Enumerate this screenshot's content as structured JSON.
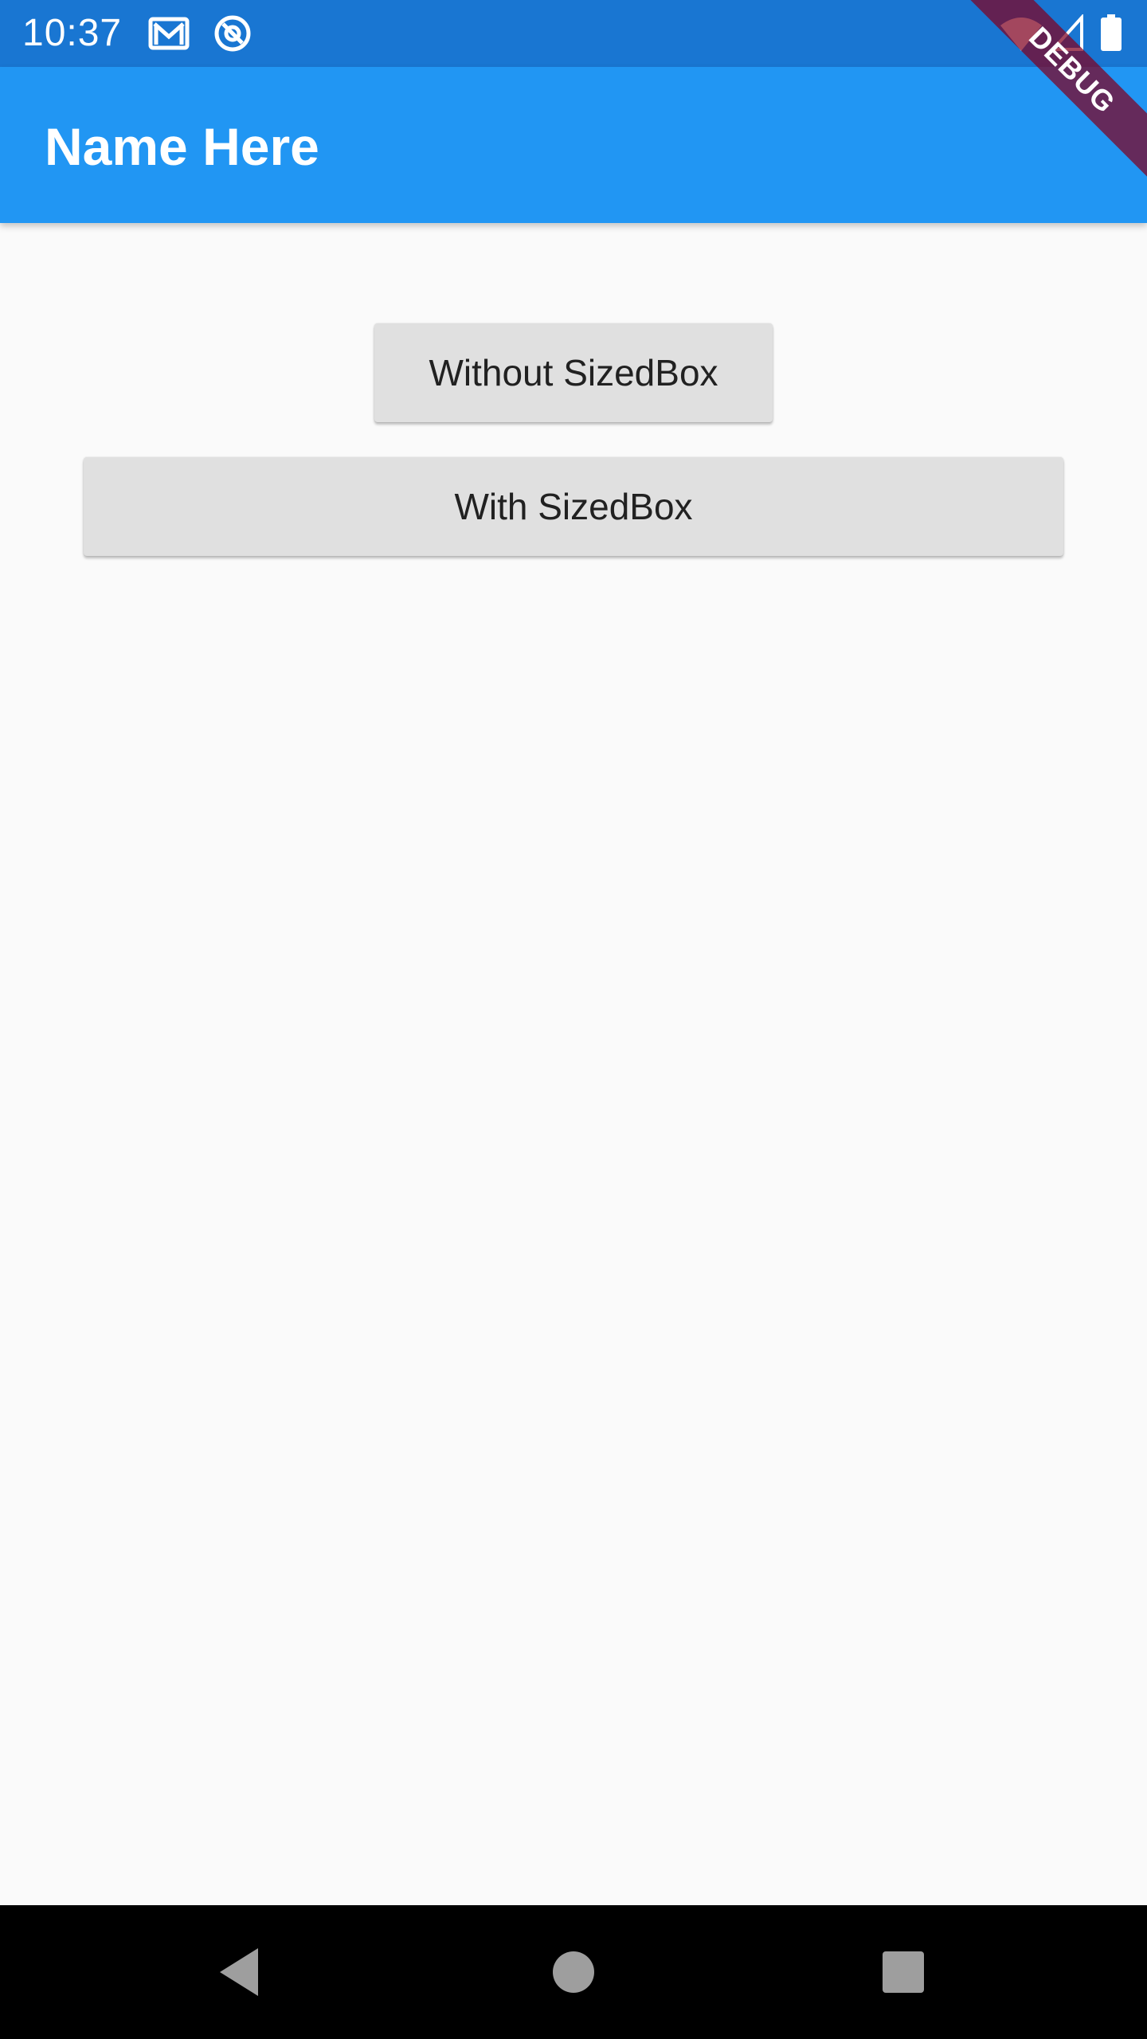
{
  "status_bar": {
    "time": "10:37",
    "background_color": "#1976d2",
    "left_icons": [
      "gmail-icon",
      "at-sign-icon"
    ],
    "right_icons": [
      "wifi-icon",
      "cell-signal-icon",
      "battery-icon"
    ]
  },
  "app_bar": {
    "title": "Name Here",
    "background_color": "#2196f3"
  },
  "debug_banner": {
    "label": "DEBUG"
  },
  "buttons": {
    "without_sizedbox": "Without SizedBox",
    "with_sizedbox": "With SizedBox"
  },
  "nav_bar": {
    "items": [
      "back-icon",
      "home-icon",
      "recents-icon"
    ]
  }
}
